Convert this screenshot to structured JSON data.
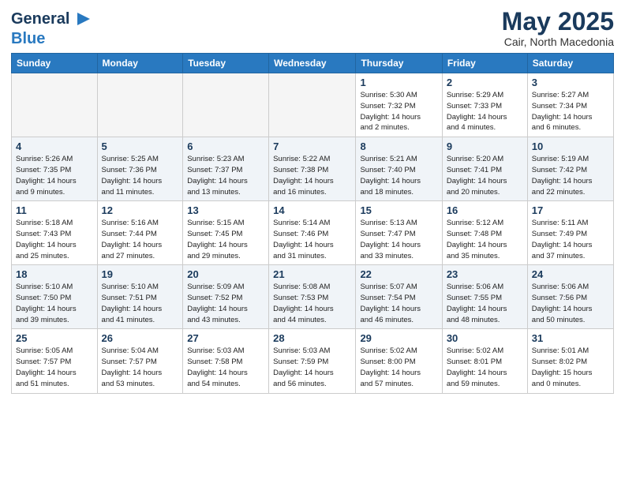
{
  "header": {
    "logo_general": "General",
    "logo_blue": "Blue",
    "month_title": "May 2025",
    "location": "Cair, North Macedonia"
  },
  "weekdays": [
    "Sunday",
    "Monday",
    "Tuesday",
    "Wednesday",
    "Thursday",
    "Friday",
    "Saturday"
  ],
  "weeks": [
    [
      {
        "day": "",
        "empty": true
      },
      {
        "day": "",
        "empty": true
      },
      {
        "day": "",
        "empty": true
      },
      {
        "day": "",
        "empty": true
      },
      {
        "day": "1",
        "info": "Sunrise: 5:30 AM\nSunset: 7:32 PM\nDaylight: 14 hours\nand 2 minutes."
      },
      {
        "day": "2",
        "info": "Sunrise: 5:29 AM\nSunset: 7:33 PM\nDaylight: 14 hours\nand 4 minutes."
      },
      {
        "day": "3",
        "info": "Sunrise: 5:27 AM\nSunset: 7:34 PM\nDaylight: 14 hours\nand 6 minutes."
      }
    ],
    [
      {
        "day": "4",
        "info": "Sunrise: 5:26 AM\nSunset: 7:35 PM\nDaylight: 14 hours\nand 9 minutes."
      },
      {
        "day": "5",
        "info": "Sunrise: 5:25 AM\nSunset: 7:36 PM\nDaylight: 14 hours\nand 11 minutes."
      },
      {
        "day": "6",
        "info": "Sunrise: 5:23 AM\nSunset: 7:37 PM\nDaylight: 14 hours\nand 13 minutes."
      },
      {
        "day": "7",
        "info": "Sunrise: 5:22 AM\nSunset: 7:38 PM\nDaylight: 14 hours\nand 16 minutes."
      },
      {
        "day": "8",
        "info": "Sunrise: 5:21 AM\nSunset: 7:40 PM\nDaylight: 14 hours\nand 18 minutes."
      },
      {
        "day": "9",
        "info": "Sunrise: 5:20 AM\nSunset: 7:41 PM\nDaylight: 14 hours\nand 20 minutes."
      },
      {
        "day": "10",
        "info": "Sunrise: 5:19 AM\nSunset: 7:42 PM\nDaylight: 14 hours\nand 22 minutes."
      }
    ],
    [
      {
        "day": "11",
        "info": "Sunrise: 5:18 AM\nSunset: 7:43 PM\nDaylight: 14 hours\nand 25 minutes."
      },
      {
        "day": "12",
        "info": "Sunrise: 5:16 AM\nSunset: 7:44 PM\nDaylight: 14 hours\nand 27 minutes."
      },
      {
        "day": "13",
        "info": "Sunrise: 5:15 AM\nSunset: 7:45 PM\nDaylight: 14 hours\nand 29 minutes."
      },
      {
        "day": "14",
        "info": "Sunrise: 5:14 AM\nSunset: 7:46 PM\nDaylight: 14 hours\nand 31 minutes."
      },
      {
        "day": "15",
        "info": "Sunrise: 5:13 AM\nSunset: 7:47 PM\nDaylight: 14 hours\nand 33 minutes."
      },
      {
        "day": "16",
        "info": "Sunrise: 5:12 AM\nSunset: 7:48 PM\nDaylight: 14 hours\nand 35 minutes."
      },
      {
        "day": "17",
        "info": "Sunrise: 5:11 AM\nSunset: 7:49 PM\nDaylight: 14 hours\nand 37 minutes."
      }
    ],
    [
      {
        "day": "18",
        "info": "Sunrise: 5:10 AM\nSunset: 7:50 PM\nDaylight: 14 hours\nand 39 minutes."
      },
      {
        "day": "19",
        "info": "Sunrise: 5:10 AM\nSunset: 7:51 PM\nDaylight: 14 hours\nand 41 minutes."
      },
      {
        "day": "20",
        "info": "Sunrise: 5:09 AM\nSunset: 7:52 PM\nDaylight: 14 hours\nand 43 minutes."
      },
      {
        "day": "21",
        "info": "Sunrise: 5:08 AM\nSunset: 7:53 PM\nDaylight: 14 hours\nand 44 minutes."
      },
      {
        "day": "22",
        "info": "Sunrise: 5:07 AM\nSunset: 7:54 PM\nDaylight: 14 hours\nand 46 minutes."
      },
      {
        "day": "23",
        "info": "Sunrise: 5:06 AM\nSunset: 7:55 PM\nDaylight: 14 hours\nand 48 minutes."
      },
      {
        "day": "24",
        "info": "Sunrise: 5:06 AM\nSunset: 7:56 PM\nDaylight: 14 hours\nand 50 minutes."
      }
    ],
    [
      {
        "day": "25",
        "info": "Sunrise: 5:05 AM\nSunset: 7:57 PM\nDaylight: 14 hours\nand 51 minutes."
      },
      {
        "day": "26",
        "info": "Sunrise: 5:04 AM\nSunset: 7:57 PM\nDaylight: 14 hours\nand 53 minutes."
      },
      {
        "day": "27",
        "info": "Sunrise: 5:03 AM\nSunset: 7:58 PM\nDaylight: 14 hours\nand 54 minutes."
      },
      {
        "day": "28",
        "info": "Sunrise: 5:03 AM\nSunset: 7:59 PM\nDaylight: 14 hours\nand 56 minutes."
      },
      {
        "day": "29",
        "info": "Sunrise: 5:02 AM\nSunset: 8:00 PM\nDaylight: 14 hours\nand 57 minutes."
      },
      {
        "day": "30",
        "info": "Sunrise: 5:02 AM\nSunset: 8:01 PM\nDaylight: 14 hours\nand 59 minutes."
      },
      {
        "day": "31",
        "info": "Sunrise: 5:01 AM\nSunset: 8:02 PM\nDaylight: 15 hours\nand 0 minutes."
      }
    ]
  ]
}
